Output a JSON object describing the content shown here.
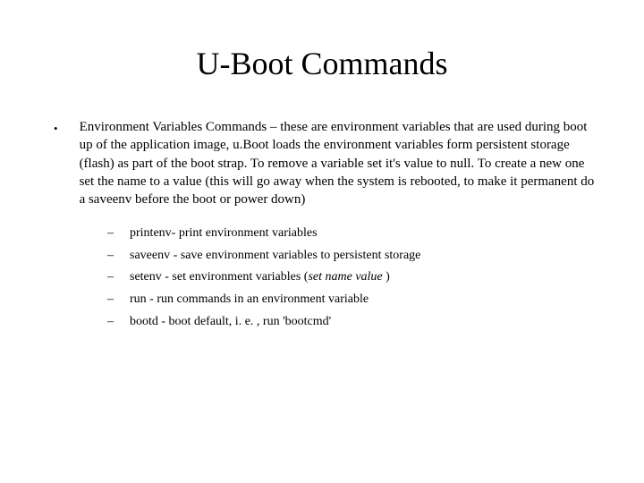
{
  "title": "U-Boot Commands",
  "main_bullet": "Environment Variables Commands – these are environment variables that are used during boot up of the application image, u.Boot loads the environment variables form persistent storage (flash) as part of the boot strap. To remove a variable set it's value to null. To create a new one set the name to a value (this will go away when the system is rebooted, to make it permanent do a saveenv before the boot or power down)",
  "sub_items": [
    {
      "text": "printenv- print environment variables"
    },
    {
      "text": "saveenv - save environment variables to persistent storage"
    },
    {
      "prefix": "setenv - set environment variables (",
      "italic": "set name value",
      "suffix": " )"
    },
    {
      "text": "run - run commands in an environment variable"
    },
    {
      "text": "bootd - boot default, i. e. , run 'bootcmd'"
    }
  ]
}
